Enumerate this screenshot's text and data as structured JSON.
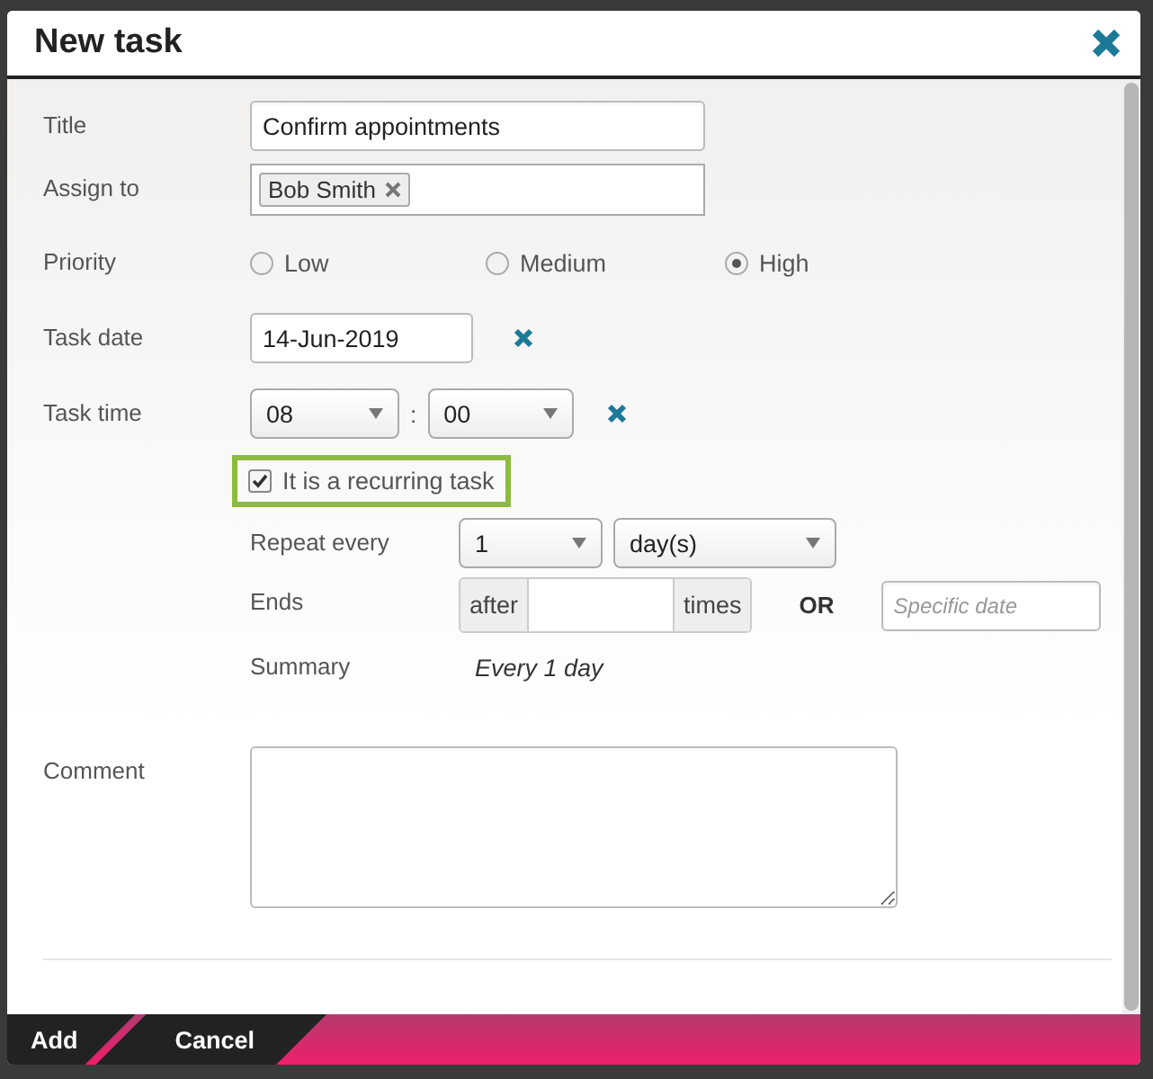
{
  "dialog": {
    "title": "New task"
  },
  "title_field": {
    "label": "Title",
    "value": "Confirm appointments"
  },
  "assign_field": {
    "label": "Assign to",
    "tags": [
      "Bob Smith"
    ]
  },
  "priority": {
    "label": "Priority",
    "options": [
      {
        "label": "Low",
        "selected": false
      },
      {
        "label": "Medium",
        "selected": false
      },
      {
        "label": "High",
        "selected": true
      }
    ]
  },
  "task_date": {
    "label": "Task date",
    "value": "14-Jun-2019"
  },
  "task_time": {
    "label": "Task time",
    "hour": "08",
    "separator": ":",
    "minute": "00"
  },
  "recurring": {
    "label": "It is a recurring task",
    "checked": true
  },
  "repeat_every": {
    "label": "Repeat every",
    "count": "1",
    "unit": "day(s)"
  },
  "ends": {
    "label": "Ends",
    "prefix": "after",
    "suffix": "times",
    "or": "OR",
    "date_placeholder": "Specific date"
  },
  "summary": {
    "label": "Summary",
    "text": "Every 1 day"
  },
  "comment": {
    "label": "Comment"
  },
  "buttons": [
    "Add",
    "Cancel"
  ]
}
